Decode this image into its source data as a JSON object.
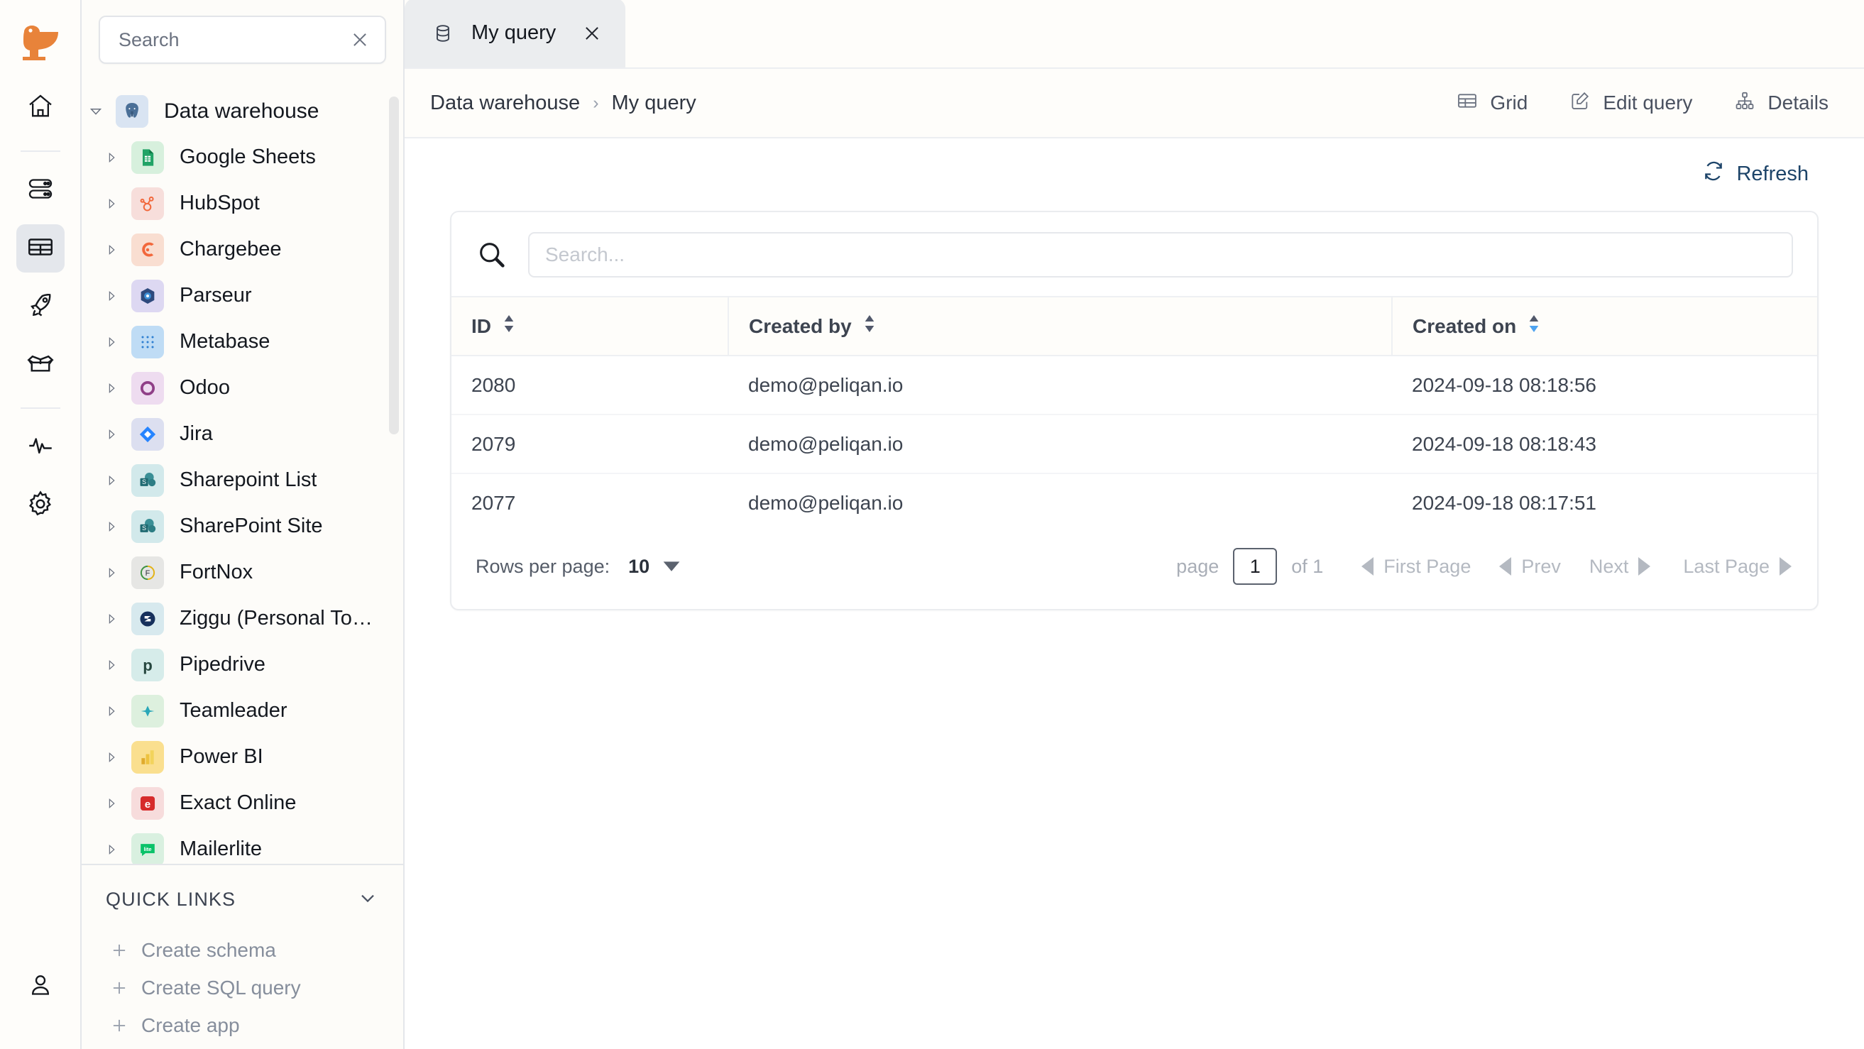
{
  "brand": {
    "logo": "peliqan-pelican-logo",
    "accent": "#e8833a"
  },
  "rail": {
    "items": [
      {
        "name": "home",
        "icon": "home-icon",
        "active": false
      },
      {
        "name": "data-sources",
        "icon": "server-stack-icon",
        "active": false
      },
      {
        "name": "data-warehouse",
        "icon": "table-grid-icon",
        "active": true
      },
      {
        "name": "pipelines",
        "icon": "rocket-icon",
        "active": false
      },
      {
        "name": "apps",
        "icon": "open-box-icon",
        "active": false
      },
      {
        "name": "activity",
        "icon": "pulse-activity-icon",
        "active": false
      },
      {
        "name": "settings",
        "icon": "gear-icon",
        "active": false
      }
    ],
    "account_icon": "user-person-icon"
  },
  "sidebar": {
    "search": {
      "placeholder": "Search",
      "value": "",
      "clear_icon": "close-x-icon"
    },
    "tree": {
      "root": {
        "label": "Data warehouse",
        "icon": "postgresql-elephant-icon",
        "expanded": true
      },
      "items": [
        {
          "label": "Google Sheets",
          "icon": "google-sheets-icon"
        },
        {
          "label": "HubSpot",
          "icon": "hubspot-icon"
        },
        {
          "label": "Chargebee",
          "icon": "chargebee-icon"
        },
        {
          "label": "Parseur",
          "icon": "parseur-icon"
        },
        {
          "label": "Metabase",
          "icon": "metabase-icon"
        },
        {
          "label": "Odoo",
          "icon": "odoo-icon"
        },
        {
          "label": "Jira",
          "icon": "jira-icon"
        },
        {
          "label": "Sharepoint List",
          "icon": "sharepoint-icon"
        },
        {
          "label": "SharePoint Site",
          "icon": "sharepoint-icon"
        },
        {
          "label": "FortNox",
          "icon": "fortnox-icon"
        },
        {
          "label": "Ziggu (Personal To…",
          "icon": "ziggu-icon"
        },
        {
          "label": "Pipedrive",
          "icon": "pipedrive-icon"
        },
        {
          "label": "Teamleader",
          "icon": "teamleader-icon"
        },
        {
          "label": "Power BI",
          "icon": "power-bi-icon"
        },
        {
          "label": "Exact Online",
          "icon": "exact-online-icon"
        },
        {
          "label": "Mailerlite",
          "icon": "mailerlite-icon"
        }
      ]
    },
    "quick_links": {
      "title": "QUICK LINKS",
      "collapse_icon": "chevron-down-icon",
      "links": [
        {
          "label": "Create schema",
          "icon": "plus-icon"
        },
        {
          "label": "Create SQL query",
          "icon": "plus-icon"
        },
        {
          "label": "Create app",
          "icon": "plus-icon"
        }
      ]
    }
  },
  "tabs": [
    {
      "label": "My query",
      "icon": "database-cylinder-icon",
      "close_icon": "close-x-icon",
      "active": true
    }
  ],
  "breadcrumb": {
    "root": "Data warehouse",
    "separator": "›",
    "current": "My query"
  },
  "toolbar": [
    {
      "label": "Grid",
      "icon": "table-grid-icon"
    },
    {
      "label": "Edit query",
      "icon": "pencil-square-icon"
    },
    {
      "label": "Details",
      "icon": "hierarchy-icon"
    }
  ],
  "refresh": {
    "label": "Refresh",
    "icon": "refresh-circular-arrows-icon",
    "color": "#1d4469"
  },
  "table": {
    "search": {
      "placeholder": "Search...",
      "value": "",
      "icon": "search-magnifier-icon"
    },
    "columns": [
      {
        "key": "id",
        "label": "ID",
        "sort": "none",
        "sort_icon": "sort-updown-icon"
      },
      {
        "key": "created_by",
        "label": "Created by",
        "sort": "none",
        "sort_icon": "sort-updown-icon"
      },
      {
        "key": "created_on",
        "label": "Created on",
        "sort": "desc",
        "sort_icon": "sort-updown-icon",
        "active_color": "#4ea3f0"
      }
    ],
    "rows": [
      {
        "id": "2080",
        "created_by": "demo@peliqan.io",
        "created_on": "2024-09-18 08:18:56"
      },
      {
        "id": "2079",
        "created_by": "demo@peliqan.io",
        "created_on": "2024-09-18 08:18:43"
      },
      {
        "id": "2077",
        "created_by": "demo@peliqan.io",
        "created_on": "2024-09-18 08:17:51"
      }
    ],
    "footer": {
      "rows_per_page_label": "Rows per page:",
      "rows_per_page_value": "10",
      "rows_per_page_caret": "caret-down-icon",
      "page_label": "page",
      "page_value": "1",
      "of_label": "of 1",
      "first_page": "First Page",
      "prev": "Prev",
      "next": "Next",
      "last_page": "Last Page"
    }
  }
}
